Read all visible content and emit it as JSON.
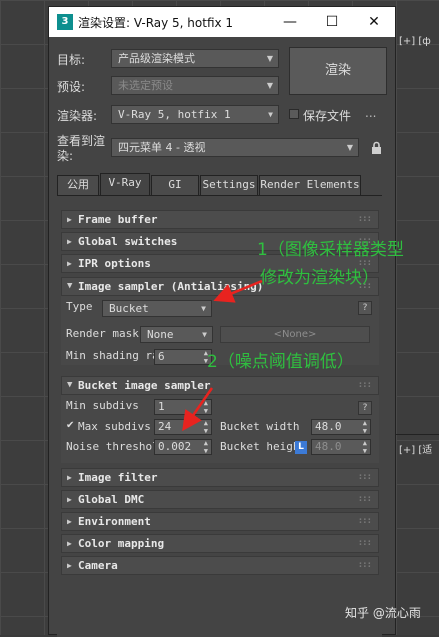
{
  "viewport": {
    "label_top": "[+] [ф",
    "label_bottom": "[+] [适"
  },
  "window": {
    "title": "渲染设置: V-Ray 5, hotfix 1",
    "icon_text": "3",
    "controls": {
      "minimize": "—",
      "maximize": "☐",
      "close": "✕"
    }
  },
  "form": {
    "target_label": "目标:",
    "target_value": "产品级渲染模式",
    "preset_label": "预设:",
    "preset_value": "未选定预设",
    "renderer_label": "渲染器:",
    "renderer_value": "V-Ray 5, hotfix 1",
    "save_file_label": "保存文件",
    "more_label": "...",
    "view_label": "查看到渲染:",
    "view_value": "四元菜单 4 - 透视",
    "render_button": "渲染"
  },
  "tabs": [
    "公用",
    "V-Ray",
    "GI",
    "Settings",
    "Render Elements"
  ],
  "active_tab": "V-Ray",
  "rollouts": {
    "frame_buffer": "Frame buffer",
    "global_switches": "Global switches",
    "ipr_options": "IPR options",
    "image_sampler": "Image sampler (Antialiasing)",
    "bucket_image_sampler": "Bucket image sampler",
    "image_filter": "Image filter",
    "global_dmc": "Global DMC",
    "environment": "Environment",
    "color_mapping": "Color mapping",
    "camera": "Camera"
  },
  "image_sampler": {
    "type_label": "Type",
    "type_value": "Bucket",
    "render_mask_label": "Render mask",
    "render_mask_value": "None",
    "none_button": "<None>",
    "min_shading_label": "Min shading ra",
    "min_shading_value": "6",
    "help": "?"
  },
  "bucket_sampler": {
    "min_subdivs_label": "Min subdivs",
    "min_subdivs_value": "1",
    "max_subdivs_label": "Max subdivs",
    "max_subdivs_value": "24",
    "bucket_width_label": "Bucket width",
    "bucket_width_value": "48.0",
    "noise_threshold_label": "Noise threshol",
    "noise_threshold_value": "0.002",
    "bucket_height_label": "Bucket heigh",
    "bucket_height_value": "48.0",
    "lock_label": "L",
    "help": "?"
  },
  "annotations": {
    "note1_line1": "1（图像采样器类型",
    "note1_line2": "修改为渲染块）",
    "note2": "2（噪点阈值调低）",
    "color": "#2fbf3f"
  },
  "watermark": "知乎 @流心雨"
}
